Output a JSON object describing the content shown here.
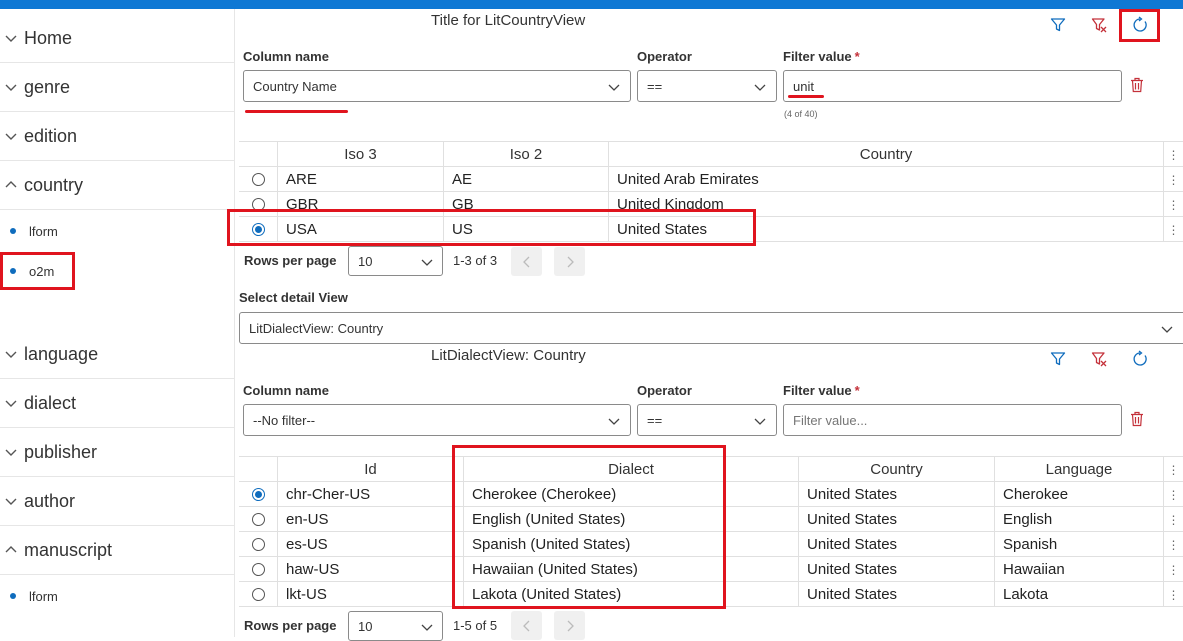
{
  "sidebar": {
    "items": [
      {
        "label": "Home",
        "state": "collapsed"
      },
      {
        "label": "genre",
        "state": "collapsed"
      },
      {
        "label": "edition",
        "state": "collapsed"
      },
      {
        "label": "country",
        "state": "expanded"
      },
      {
        "label": "language",
        "state": "collapsed"
      },
      {
        "label": "dialect",
        "state": "collapsed"
      },
      {
        "label": "publisher",
        "state": "collapsed"
      },
      {
        "label": "author",
        "state": "collapsed"
      },
      {
        "label": "manuscript",
        "state": "expanded"
      }
    ],
    "country_children": [
      "lform",
      "o2m"
    ],
    "manuscript_children": [
      "lform"
    ]
  },
  "country_view": {
    "title": "Title for LitCountryView",
    "column_name_label": "Column name",
    "operator_label": "Operator",
    "filter_value_label": "Filter value",
    "required_mark": "*",
    "column_name_value": "Country Name",
    "operator_value": "==",
    "filter_value": "unit",
    "match_counter": "(4 of 40)",
    "columns": [
      "Iso 3",
      "Iso 2",
      "Country"
    ],
    "rows": [
      {
        "iso3": "ARE",
        "iso2": "AE",
        "country": "United Arab Emirates",
        "selected": false
      },
      {
        "iso3": "GBR",
        "iso2": "GB",
        "country": "United Kingdom",
        "selected": false
      },
      {
        "iso3": "USA",
        "iso2": "US",
        "country": "United States",
        "selected": true
      }
    ],
    "rows_per_page_label": "Rows per page",
    "rows_per_page": "10",
    "range": "1-3 of 3"
  },
  "detail_selector": {
    "label": "Select detail View",
    "value": "LitDialectView: Country"
  },
  "dialect_view": {
    "title": "LitDialectView: Country",
    "column_name_label": "Column name",
    "operator_label": "Operator",
    "filter_value_label": "Filter value",
    "required_mark": "*",
    "column_name_value": "--No filter--",
    "operator_value": "==",
    "filter_placeholder": "Filter value...",
    "columns": [
      "Id",
      "Dialect",
      "Country",
      "Language"
    ],
    "rows": [
      {
        "id": "chr-Cher-US",
        "dialect": "Cherokee (Cherokee)",
        "country": "United States",
        "language": "Cherokee",
        "selected": true
      },
      {
        "id": "en-US",
        "dialect": "English (United States)",
        "country": "United States",
        "language": "English",
        "selected": false
      },
      {
        "id": "es-US",
        "dialect": "Spanish (United States)",
        "country": "United States",
        "language": "Spanish",
        "selected": false
      },
      {
        "id": "haw-US",
        "dialect": "Hawaiian (United States)",
        "country": "United States",
        "language": "Hawaiian",
        "selected": false
      },
      {
        "id": "lkt-US",
        "dialect": "Lakota (United States)",
        "country": "United States",
        "language": "Lakota",
        "selected": false
      }
    ],
    "rows_per_page_label": "Rows per page",
    "rows_per_page": "10",
    "range": "1-5 of 5"
  },
  "icons": {
    "filter": "filter-icon",
    "clear_filter": "clear-filter-icon",
    "refresh": "refresh-icon",
    "delete": "trash-icon",
    "more": "more-vertical-icon"
  },
  "colors": {
    "accent": "#0f6cbd",
    "topbar": "#0f78d4",
    "annotation_red": "#e0141e",
    "danger": "#c4313a"
  }
}
